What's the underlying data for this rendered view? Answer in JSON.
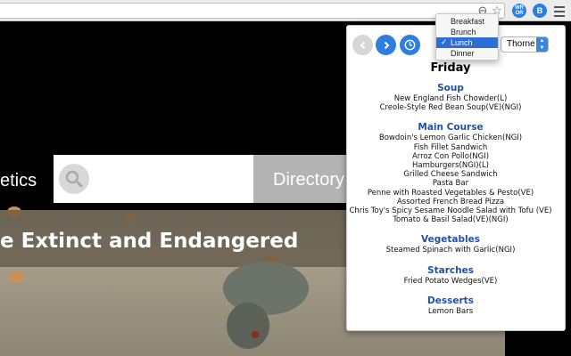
{
  "browser": {
    "icons": [
      "zoom-icon",
      "star-icon",
      "extension-icon",
      "b-extension-icon",
      "menu-icon"
    ],
    "ext1_label": "WR OR",
    "ext2_label": "B"
  },
  "site": {
    "nav_partial": "etics",
    "search_placeholder": "",
    "directory_label": "Directory",
    "hero_title": "e Extinct and Endangered"
  },
  "popup": {
    "day": "Friday",
    "hall_select": "Thorne",
    "meal_options": [
      "Breakfast",
      "Brunch",
      "Lunch",
      "Dinner"
    ],
    "selected_meal": "Lunch",
    "accent_color": "#2f7de0",
    "category_color": "#2150a8",
    "sections": [
      {
        "name": "Soup",
        "items": [
          "New England Fish Chowder(L)",
          "Creole-Style Red Bean Soup(VE)(NGI)"
        ]
      },
      {
        "name": "Main Course",
        "items": [
          "Bowdoin's Lemon Garlic Chicken(NGI)",
          "Fish Fillet Sandwich",
          "Arroz Con Pollo(NGI)",
          "Hamburgers(NGI)(L)",
          "Grilled Cheese Sandwich",
          "Pasta Bar",
          "Penne with Roasted Vegetables & Pesto(VE)",
          "Assorted French Bread Pizza",
          "Chris Toy's Spicy Sesame Noodle Salad with Tofu (VE)",
          "Tomato & Basil Salad(VE)(NGI)"
        ]
      },
      {
        "name": "Vegetables",
        "items": [
          "Steamed Spinach with Garlic(NGI)"
        ]
      },
      {
        "name": "Starches",
        "items": [
          "Fried Potato Wedges(VE)"
        ]
      },
      {
        "name": "Desserts",
        "items": [
          "Lemon Bars"
        ]
      }
    ]
  }
}
